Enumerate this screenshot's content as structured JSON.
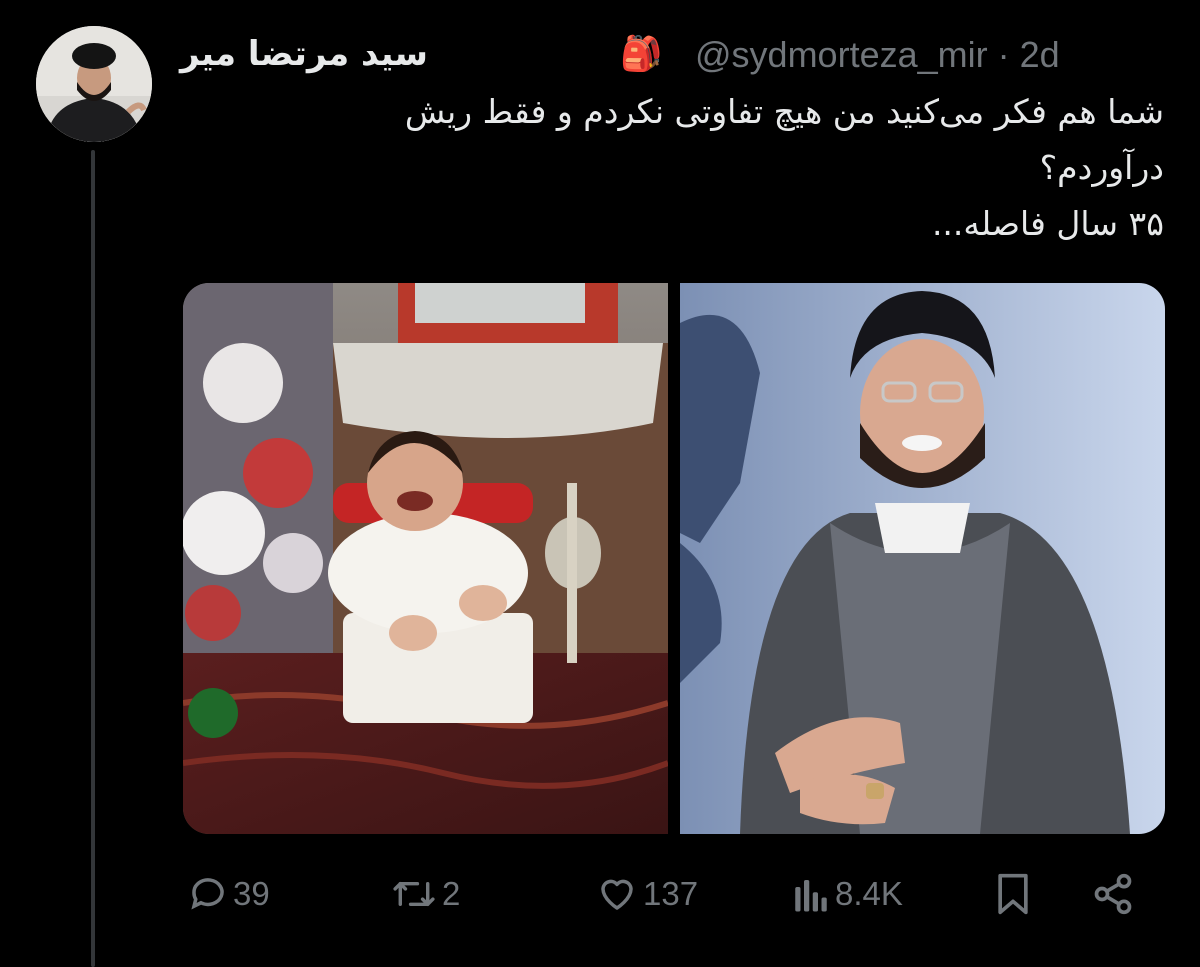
{
  "tweet": {
    "display_name": "سید مرتضا میر",
    "name_emoji": "🎒",
    "handle_and_time": "@sydmorteza_mir · 2d",
    "text_lines": [
      "شما هم فکر می‌کنید من هیچ تفاوتی نکردم و فقط ریش",
      "درآوردم؟",
      "۳۵ سال فاصله..."
    ]
  },
  "media": {
    "left_photo": "childhood-photo",
    "right_photo": "adult-cleric-photo"
  },
  "actions": {
    "replies": "39",
    "reposts": "2",
    "likes": "137",
    "views": "8.4K"
  },
  "icons": {
    "reply": "reply-icon",
    "repost": "repost-icon",
    "like": "heart-icon",
    "views": "views-icon",
    "bookmark": "bookmark-icon",
    "share": "share-icon"
  },
  "colors": {
    "background": "#000000",
    "text": "#e7e9ea",
    "muted": "#71767b"
  }
}
